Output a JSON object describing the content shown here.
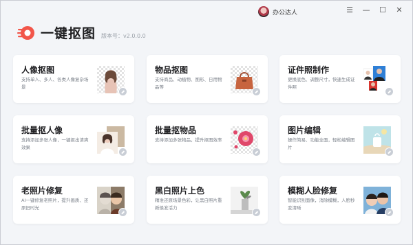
{
  "header": {
    "user_name": "办公达人",
    "app_title": "一键抠图",
    "version": "版本号：v2.0.0.0"
  },
  "window_controls": [
    "☰",
    "—",
    "☐",
    "✕"
  ],
  "colors": {
    "accent": "#f2564a",
    "background": "#f3f5f8",
    "card": "#ffffff"
  },
  "cards": [
    {
      "title": "人像抠图",
      "desc": "支持单人、多人、各类人像复杂场景",
      "icon": "portrait-cutout-icon"
    },
    {
      "title": "物品抠图",
      "desc": "支持商品、动植物、图形、日用物品等",
      "icon": "bag-cutout-icon"
    },
    {
      "title": "证件照制作",
      "desc": "更换底色、调整尺寸，快速生成证件照",
      "icon": "id-photo-icon"
    },
    {
      "title": "批量抠人像",
      "desc": "支持添加多张人像，一键抠出清爽效果",
      "icon": "batch-portrait-icon"
    },
    {
      "title": "批量抠物品",
      "desc": "支持添加多张物品，提升抠图效率",
      "icon": "batch-item-icon"
    },
    {
      "title": "图片编辑",
      "desc": "操作简易、功能全面，轻松编辑图片",
      "icon": "image-edit-icon"
    },
    {
      "title": "老照片修复",
      "desc": "AI一键修复老照片，提升画质、还原旧时光",
      "icon": "old-photo-icon"
    },
    {
      "title": "黑白照片上色",
      "desc": "精准还原场景色彩，让黑白照片重新焕发活力",
      "icon": "colorize-icon"
    },
    {
      "title": "模糊人脸修复",
      "desc": "智能识别面像，消除模糊，人脸秒变清晰",
      "icon": "face-restore-icon"
    }
  ]
}
